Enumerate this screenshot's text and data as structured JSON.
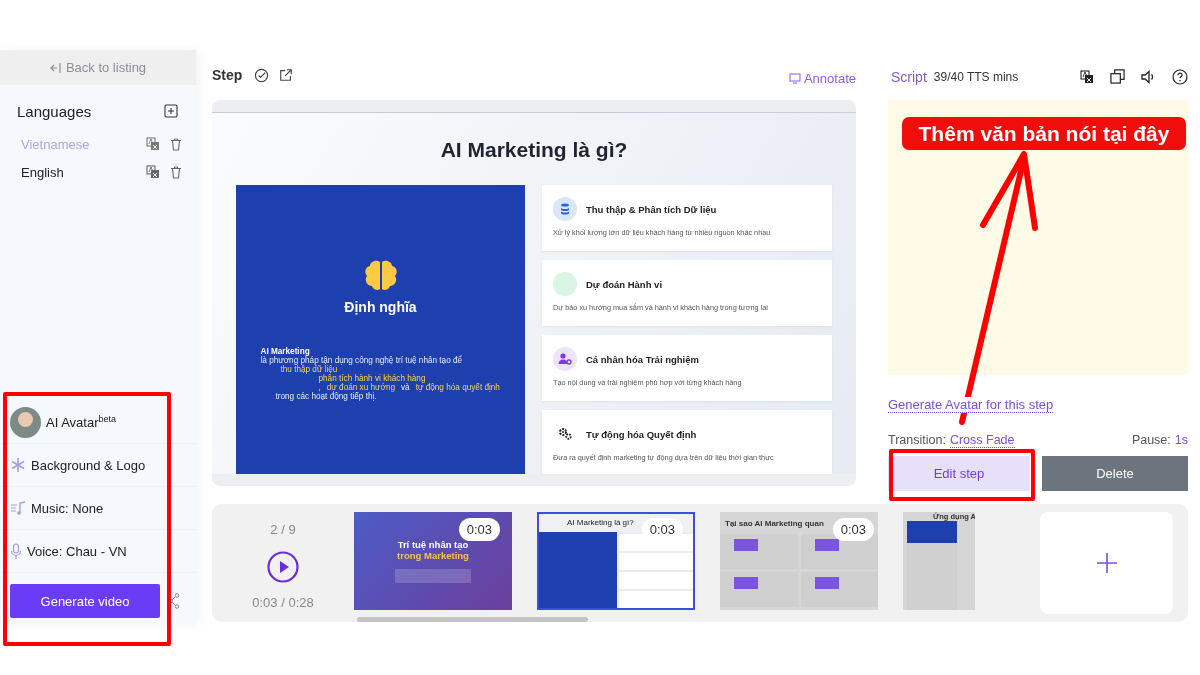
{
  "sidebar": {
    "back_link": "Back to listing",
    "languages_title": "Languages",
    "languages": [
      {
        "name": "Vietnamese",
        "selected": true
      },
      {
        "name": "English",
        "selected": false
      }
    ],
    "settings": [
      {
        "kind": "avatar",
        "label": "AI Avatar$^{beta}$"
      },
      {
        "kind": "background",
        "label": "Background & Logo"
      },
      {
        "kind": "music",
        "label": "Music: None"
      },
      {
        "kind": "voice",
        "label": "Voice: Chau - VN"
      }
    ],
    "generate_button": "Generate video"
  },
  "step": {
    "title": "Step",
    "annotate": "Annotate"
  },
  "slide": {
    "title": "AI Marketing là gì?",
    "panel_title": "Định nghĩa",
    "definition_term": "AI Marketing",
    "definition": [
      [
        {
          "text": "là phương pháp tận dụng công nghệ trí tuệ nhân tạo để",
          "highlight": false
        }
      ],
      [
        {
          "text": "thu thập dữ liệu",
          "highlight": true
        }
      ],
      [
        {
          "text": "phân tích hành vi khách hàng",
          "highlight": true
        }
      ],
      [
        {
          "text": ",",
          "highlight": false
        },
        {
          "text": "dự đoán xu hướng",
          "highlight": true
        },
        {
          "text": "và",
          "highlight": false
        },
        {
          "text": "tự động hóa quyết định",
          "highlight": true
        }
      ],
      [
        {
          "text": "trong các hoạt động tiếp thị.",
          "highlight": false
        }
      ]
    ],
    "cards": [
      {
        "title": "Thu thập & Phân tích Dữ liệu",
        "text": "Xử lý khối lượng lớn dữ liệu khách hàng từ nhiều nguồn khác nhau"
      },
      {
        "title": "Dự đoán Hành vi",
        "text": "Dự báo xu hướng mua sắm và hành vi khách hàng trong tương lai"
      },
      {
        "title": "Cá nhân hóa Trải nghiệm",
        "text": "Tạo nội dung và trải nghiệm phù hợp với từng khách hàng"
      },
      {
        "title": "Tự động hóa Quyết định",
        "text": "Đưa ra quyết định marketing tự động dựa trên dữ liệu thời gian thực"
      }
    ]
  },
  "timeline": {
    "position": "2 / 9",
    "time": "0:03 / 0:28",
    "thumbnails": [
      {
        "kind": "title",
        "title": "Trí tuệ nhân tạo",
        "subtitle": "trong Marketing",
        "duration": "0:03",
        "selected": false
      },
      {
        "kind": "split",
        "title": "AI Marketing là gì?",
        "duration": "0:03",
        "selected": true
      },
      {
        "kind": "grid",
        "title": "Tại sao AI Marketing quan",
        "duration": "0:03",
        "selected": false
      },
      {
        "kind": "columns",
        "title": "Ứng dụng A",
        "selected": false
      }
    ]
  },
  "script": {
    "title": "Script",
    "quota": "39/40 TTS mins",
    "avatar_link": "Generate Avatar for this step",
    "transition_label": "Transition:",
    "transition_value": "Cross Fade",
    "pause_label": "Pause:",
    "pause_value": "1s",
    "edit_button": "Edit step",
    "delete_button": "Delete"
  },
  "annotations": {
    "callout": "Thêm văn bản nói tại đây"
  }
}
